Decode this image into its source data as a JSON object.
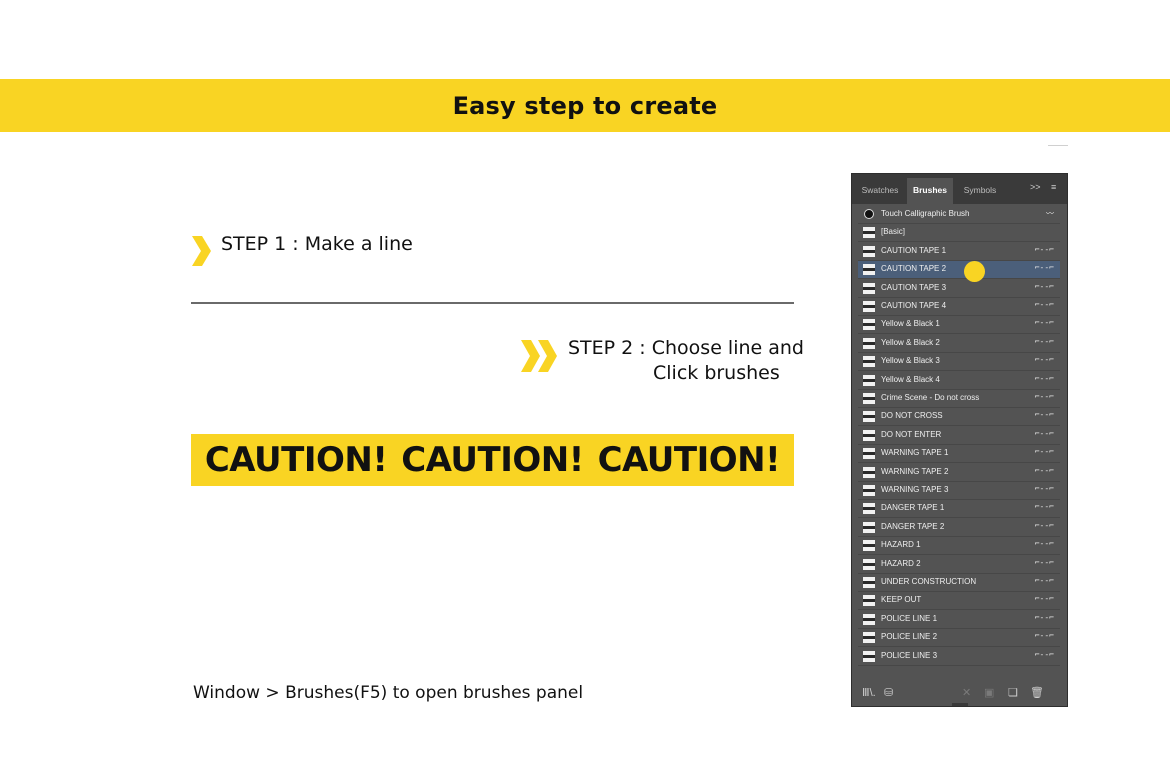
{
  "banner": {
    "title": "Easy step to create"
  },
  "steps": [
    {
      "label": "STEP 1 : Make a line"
    },
    {
      "label_line1": "STEP 2 : Choose line and",
      "label_line2": "Click brushes"
    }
  ],
  "caution_strip": {
    "words": [
      "CAUTION!",
      "CAUTION!",
      "CAUTION!"
    ]
  },
  "footer_note": "Window > Brushes(F5) to open brushes panel",
  "colors": {
    "accent": "#f9d423",
    "panel_bg": "#535353",
    "tabbar_bg": "#3a3a3a",
    "selected_row": "#4b5f7a"
  },
  "brushes_panel": {
    "tabs": [
      {
        "label": "Swatches",
        "active": false
      },
      {
        "label": "Brushes",
        "active": true
      },
      {
        "label": "Symbols",
        "active": false
      }
    ],
    "tab_controls": {
      "expand": ">>",
      "menu": "≡"
    },
    "selected_index": 3,
    "items": [
      {
        "label": "Touch Calligraphic Brush",
        "swatch": "black-dot-icon",
        "glyph": "〰"
      },
      {
        "label": "[Basic]",
        "swatch": "line-swatch-icon",
        "glyph": ""
      },
      {
        "label": "CAUTION TAPE 1",
        "swatch": "line-swatch-icon",
        "glyph": "⌐--⌐"
      },
      {
        "label": "CAUTION TAPE 2",
        "swatch": "line-swatch-icon",
        "glyph": "⌐--⌐"
      },
      {
        "label": "CAUTION TAPE 3",
        "swatch": "line-swatch-icon",
        "glyph": "⌐--⌐"
      },
      {
        "label": "CAUTION TAPE 4",
        "swatch": "line-swatch-icon",
        "glyph": "⌐--⌐"
      },
      {
        "label": "Yellow & Black 1",
        "swatch": "line-swatch-icon",
        "glyph": "⌐--⌐"
      },
      {
        "label": "Yellow & Black 2",
        "swatch": "line-swatch-icon",
        "glyph": "⌐--⌐"
      },
      {
        "label": "Yellow & Black 3",
        "swatch": "line-swatch-icon",
        "glyph": "⌐--⌐"
      },
      {
        "label": "Yellow & Black 4",
        "swatch": "line-swatch-icon",
        "glyph": "⌐--⌐"
      },
      {
        "label": "Crime Scene - Do not cross",
        "swatch": "line-swatch-icon",
        "glyph": "⌐--⌐"
      },
      {
        "label": "DO NOT CROSS",
        "swatch": "line-swatch-icon",
        "glyph": "⌐--⌐"
      },
      {
        "label": "DO NOT ENTER",
        "swatch": "line-swatch-icon",
        "glyph": "⌐--⌐"
      },
      {
        "label": "WARNING TAPE 1",
        "swatch": "line-swatch-icon",
        "glyph": "⌐--⌐"
      },
      {
        "label": "WARNING TAPE 2",
        "swatch": "line-swatch-icon",
        "glyph": "⌐--⌐"
      },
      {
        "label": "WARNING TAPE 3",
        "swatch": "line-swatch-icon",
        "glyph": "⌐--⌐"
      },
      {
        "label": "DANGER TAPE 1",
        "swatch": "line-swatch-icon",
        "glyph": "⌐--⌐"
      },
      {
        "label": "DANGER TAPE 2",
        "swatch": "line-swatch-icon",
        "glyph": "⌐--⌐"
      },
      {
        "label": "HAZARD 1",
        "swatch": "line-swatch-icon",
        "glyph": "⌐--⌐"
      },
      {
        "label": "HAZARD 2",
        "swatch": "line-swatch-icon",
        "glyph": "⌐--⌐"
      },
      {
        "label": "UNDER CONSTRUCTION",
        "swatch": "line-swatch-icon",
        "glyph": "⌐--⌐"
      },
      {
        "label": "KEEP OUT",
        "swatch": "line-swatch-icon",
        "glyph": "⌐--⌐"
      },
      {
        "label": "POLICE LINE 1",
        "swatch": "line-swatch-icon",
        "glyph": "⌐--⌐"
      },
      {
        "label": "POLICE LINE 2",
        "swatch": "line-swatch-icon",
        "glyph": "⌐--⌐"
      },
      {
        "label": "POLICE LINE 3",
        "swatch": "line-swatch-icon",
        "glyph": "⌐--⌐"
      }
    ],
    "bottom_icons": [
      {
        "name": "brush-libraries-icon",
        "glyph": "Ⅲ\\.",
        "enabled": true
      },
      {
        "name": "libraries-panel-icon",
        "glyph": "⛁",
        "enabled": true
      },
      {
        "name": "remove-stroke-icon",
        "glyph": "✕",
        "enabled": false
      },
      {
        "name": "brush-options-icon",
        "glyph": "▣",
        "enabled": false
      },
      {
        "name": "new-brush-icon",
        "glyph": "❏",
        "enabled": true
      },
      {
        "name": "delete-brush-icon",
        "glyph": "🗑",
        "enabled": true
      }
    ]
  }
}
